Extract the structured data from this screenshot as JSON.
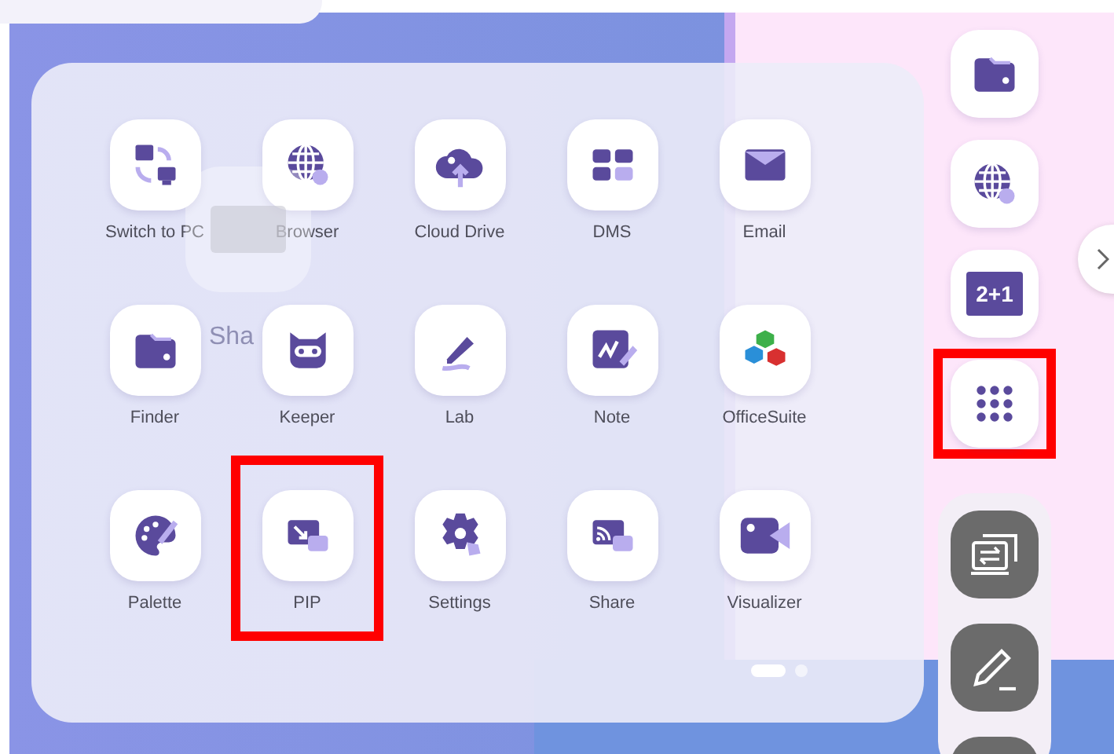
{
  "launcher": {
    "apps": [
      {
        "label": "Switch to PC",
        "highlighted": false
      },
      {
        "label": "Browser",
        "highlighted": false
      },
      {
        "label": "Cloud Drive",
        "highlighted": false
      },
      {
        "label": "DMS",
        "highlighted": false
      },
      {
        "label": "Email",
        "highlighted": false
      },
      {
        "label": "Finder",
        "highlighted": false
      },
      {
        "label": "Keeper",
        "highlighted": false
      },
      {
        "label": "Lab",
        "highlighted": false
      },
      {
        "label": "Note",
        "highlighted": false
      },
      {
        "label": "OfficeSuite",
        "highlighted": false
      },
      {
        "label": "Palette",
        "highlighted": false
      },
      {
        "label": "PIP",
        "highlighted": true
      },
      {
        "label": "Settings",
        "highlighted": false
      },
      {
        "label": "Share",
        "highlighted": false
      },
      {
        "label": "Visualizer",
        "highlighted": false
      }
    ],
    "pages": [
      {
        "selected": true
      },
      {
        "selected": false
      }
    ],
    "drag_ghost": {
      "label": "Sha"
    }
  },
  "dock": {
    "items": [
      {
        "kind": "light",
        "highlighted": false
      },
      {
        "kind": "light",
        "highlighted": false
      },
      {
        "kind": "light",
        "text": "2+1",
        "highlighted": false
      },
      {
        "kind": "light",
        "highlighted": true
      },
      {
        "kind": "dark",
        "highlighted": false
      },
      {
        "kind": "dark",
        "highlighted": false
      },
      {
        "kind": "dark",
        "highlighted": false
      }
    ]
  }
}
